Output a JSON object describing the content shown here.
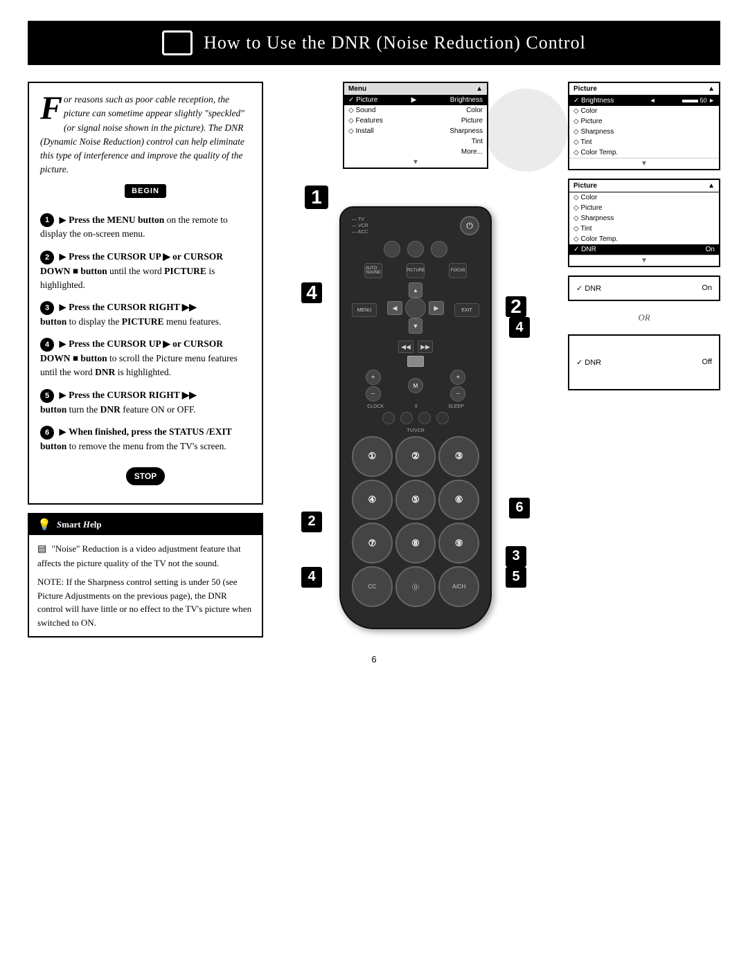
{
  "header": {
    "title": "How to Use the DNR (Noise Reduction) Control",
    "title_prefix": "H",
    "title_normal1": "ow to ",
    "title_bold1": "U",
    "title_normal2": "se the ",
    "title_bold2": "DNR (N",
    "title_normal3": "oise ",
    "title_bold3": "R",
    "title_normal4": "eduction) ",
    "title_bold4": "C",
    "title_normal5": "ontrol"
  },
  "intro": {
    "drop_cap": "F",
    "text": "or reasons such as poor cable reception, the picture can sometime appear slightly \"speckled\" (or signal noise shown in the picture). The DNR (Dynamic Noise Reduction) control can help eliminate this type of interference and improve the quality of the picture."
  },
  "begin_label": "BEGIN",
  "steps": [
    {
      "number": "1",
      "text": "Press the MENU button on the remote to display the on-screen menu."
    },
    {
      "number": "2",
      "text": "Press the CURSOR UP ▶ or CURSOR DOWN ■ button until the word PICTURE is highlighted."
    },
    {
      "number": "3",
      "text": "Press the CURSOR RIGHT ▶▶ button to display the PICTURE menu features."
    },
    {
      "number": "4",
      "text": "Press the CURSOR UP ▶ or CURSOR DOWN ■ button to scroll the Picture menu features until the word DNR is highlighted."
    },
    {
      "number": "5",
      "text": "Press the CURSOR RIGHT ▶▶ button turn the DNR feature ON or OFF."
    },
    {
      "number": "6",
      "text": "When finished, press the STATUS /EXIT button to remove the menu from the TV's screen."
    }
  ],
  "stop_label": "STOP",
  "smart_help": {
    "title": "Smart Help",
    "content1": "\"Noise\" Reduction is a video adjustment feature that affects the picture quality of the TV not the sound.",
    "content2": "NOTE: If the Sharpness control setting is under 50 (see Picture Adjustments on the previous page), the DNR control will have little or no effect to the TV's picture when switched to ON."
  },
  "menu_screen1": {
    "rows": [
      {
        "label": "Menu",
        "value": "▲",
        "selected": false,
        "header": true
      },
      {
        "label": "✓ Picture",
        "value": "▶",
        "selected": true
      },
      {
        "label": "◇ Sound",
        "value": "Color",
        "selected": false
      },
      {
        "label": "◇ Features",
        "value": "Picture",
        "selected": false
      },
      {
        "label": "◇ Install",
        "value": "Sharpness",
        "selected": false
      },
      {
        "label": "",
        "value": "Tint",
        "selected": false
      },
      {
        "label": "",
        "value": "More...",
        "selected": false
      },
      {
        "label": "▼",
        "value": "",
        "selected": false
      }
    ]
  },
  "screen_box2": {
    "header": "Picture",
    "rows": [
      {
        "label": "✓ Brightness",
        "value": "◄ ————— 50 ►",
        "selected": true
      },
      {
        "label": "◇ Color",
        "value": "",
        "selected": false
      },
      {
        "label": "◇ Picture",
        "value": "",
        "selected": false
      },
      {
        "label": "◇ Sharpness",
        "value": "",
        "selected": false
      },
      {
        "label": "◇ Tint",
        "value": "",
        "selected": false
      },
      {
        "label": "◇ Color Temp.",
        "value": "",
        "selected": false
      }
    ],
    "footer": "▼"
  },
  "screen_box3": {
    "header": "Picture",
    "rows": [
      {
        "label": "◇ Color",
        "value": "",
        "selected": false
      },
      {
        "label": "◇ Picture",
        "value": "",
        "selected": false
      },
      {
        "label": "◇ Sharpness",
        "value": "",
        "selected": false
      },
      {
        "label": "◇ Tint",
        "value": "",
        "selected": false
      },
      {
        "label": "◇ Color Temp.",
        "value": "",
        "selected": false
      },
      {
        "label": "✓ DNR",
        "value": "On",
        "selected": true
      }
    ],
    "footer": "▼"
  },
  "screen_box4": {
    "rows": [
      {
        "label": "✓ DNR",
        "value": "On"
      }
    ]
  },
  "or_label": "OR",
  "screen_box5": {
    "rows": [
      {
        "label": "✓ DNR",
        "value": "Off"
      }
    ]
  },
  "remote": {
    "labels": [
      "TV",
      "VCR",
      "ACC"
    ],
    "power_label": "⏻",
    "menu_label": "MENU",
    "exit_label": "EXIT",
    "auto_sound_label": "AUTO SOUND",
    "picture_label": "PICTURE",
    "focus_label": "FOCUS",
    "numbers": [
      "1",
      "2",
      "3",
      "4",
      "5",
      "6",
      "7",
      "8",
      "9"
    ],
    "bottom": [
      "CC",
      "0",
      "A/CH"
    ]
  },
  "page_number": "6"
}
